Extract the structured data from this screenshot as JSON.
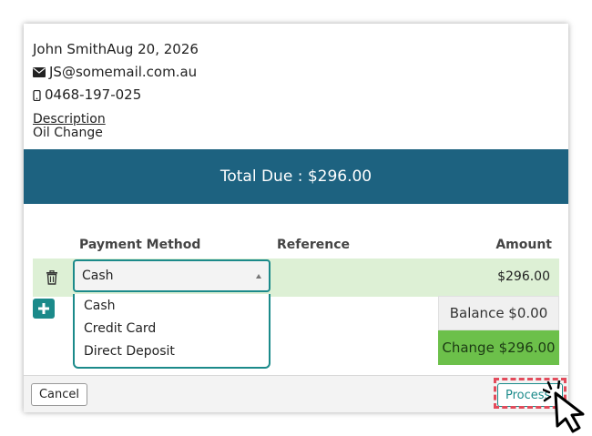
{
  "customer": {
    "name": "John Smith",
    "date": "Aug 20, 2026",
    "email": "JS@somemail.com.au",
    "phone": "0468-197-025",
    "description_label": "Description",
    "description_value": "Oil Change"
  },
  "total": {
    "label": "Total Due : $296.00"
  },
  "table": {
    "headers": {
      "payment_method": "Payment Method",
      "reference": "Reference",
      "amount": "Amount"
    },
    "row": {
      "method": "Cash",
      "amount": "$296.00"
    }
  },
  "dropdown": {
    "options": [
      "Cash",
      "Credit Card",
      "Direct Deposit"
    ]
  },
  "summary": {
    "balance": "Balance $0.00",
    "change": "Change $296.00"
  },
  "footer": {
    "cancel_label": "Cancel",
    "process_label": "Process"
  },
  "colors": {
    "total_bar": "#1d6280",
    "accent": "#1b8a8a",
    "row_bg": "#ddf0d5",
    "change_bg": "#6cc04a",
    "highlight": "#e34b5b"
  },
  "icons": {
    "email": "envelope-icon",
    "phone": "mobile-phone-icon",
    "delete": "trash-icon",
    "add": "plus-icon",
    "cursor": "pointer-cursor-icon"
  }
}
